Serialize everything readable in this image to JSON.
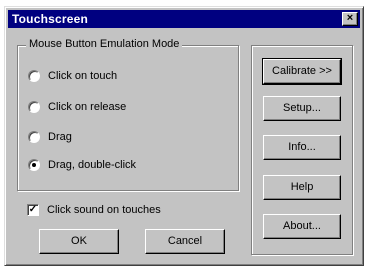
{
  "window": {
    "title": "Touchscreen",
    "close_glyph": "×"
  },
  "mode_group": {
    "legend": "Mouse Button Emulation Mode",
    "options": [
      {
        "label": "Click on touch",
        "checked": false
      },
      {
        "label": "Click on release",
        "checked": false
      },
      {
        "label": "Drag",
        "checked": false
      },
      {
        "label": "Drag, double-click",
        "checked": true
      }
    ]
  },
  "click_sound": {
    "label": "Click sound on touches",
    "checked": true,
    "check_glyph": "✓"
  },
  "buttons": {
    "ok": "OK",
    "cancel": "Cancel",
    "calibrate": "Calibrate >>",
    "setup": "Setup...",
    "info": "Info...",
    "help": "Help",
    "about": "About..."
  }
}
